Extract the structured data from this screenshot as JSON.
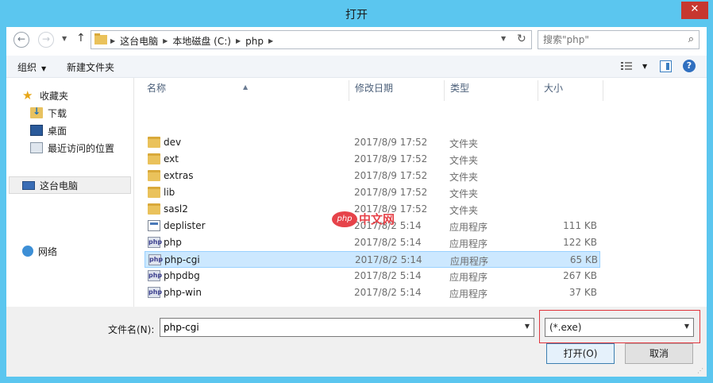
{
  "window": {
    "title": "打开",
    "close_glyph": "✕"
  },
  "address": {
    "crumbs": [
      "这台电脑",
      "本地磁盘 (C:)",
      "php"
    ],
    "search_placeholder": "搜索\"php\""
  },
  "toolbar": {
    "organize": "组织",
    "new_folder": "新建文件夹"
  },
  "nav": {
    "favorites": "收藏夹",
    "downloads": "下载",
    "desktop": "桌面",
    "recent": "最近访问的位置",
    "this_pc": "这台电脑",
    "network": "网络"
  },
  "columns": {
    "name": "名称",
    "date": "修改日期",
    "type": "类型",
    "size": "大小"
  },
  "files": [
    {
      "name": "dev",
      "date": "2017/8/9 17:52",
      "type": "文件夹",
      "size": "",
      "icon": "folder"
    },
    {
      "name": "ext",
      "date": "2017/8/9 17:52",
      "type": "文件夹",
      "size": "",
      "icon": "folder"
    },
    {
      "name": "extras",
      "date": "2017/8/9 17:52",
      "type": "文件夹",
      "size": "",
      "icon": "folder"
    },
    {
      "name": "lib",
      "date": "2017/8/9 17:52",
      "type": "文件夹",
      "size": "",
      "icon": "folder"
    },
    {
      "name": "sasl2",
      "date": "2017/8/9 17:52",
      "type": "文件夹",
      "size": "",
      "icon": "folder"
    },
    {
      "name": "deplister",
      "date": "2017/8/2 5:14",
      "type": "应用程序",
      "size": "111 KB",
      "icon": "exe"
    },
    {
      "name": "php",
      "date": "2017/8/2 5:14",
      "type": "应用程序",
      "size": "122 KB",
      "icon": "php"
    },
    {
      "name": "php-cgi",
      "date": "2017/8/2 5:14",
      "type": "应用程序",
      "size": "65 KB",
      "icon": "php",
      "selected": true
    },
    {
      "name": "phpdbg",
      "date": "2017/8/2 5:14",
      "type": "应用程序",
      "size": "267 KB",
      "icon": "php"
    },
    {
      "name": "php-win",
      "date": "2017/8/2 5:14",
      "type": "应用程序",
      "size": "37 KB",
      "icon": "php"
    }
  ],
  "bottom": {
    "filename_label": "文件名(N):",
    "filename_value": "php-cgi",
    "filter_value": "(*.exe)",
    "open_button": "打开(O)",
    "cancel_button": "取消"
  },
  "watermark": {
    "badge": "php",
    "text": "中文网"
  },
  "colors": {
    "titlebar": "#5bc6ef",
    "selection": "#cce8ff",
    "highlight_border": "#e0343c",
    "close": "#c7372f"
  }
}
